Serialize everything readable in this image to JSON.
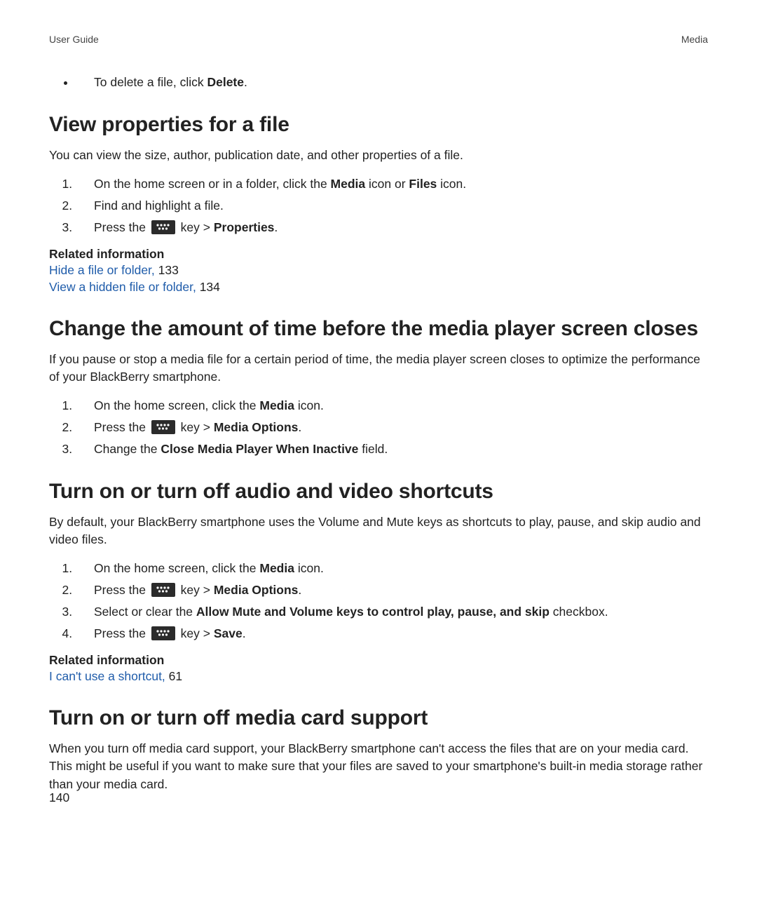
{
  "header": {
    "left": "User Guide",
    "right": "Media"
  },
  "bullet0": {
    "pre": "To delete a file, click ",
    "bold": "Delete",
    "post": "."
  },
  "sec1": {
    "title": "View properties for a file",
    "intro": "You can view the size, author, publication date, and other properties of a file.",
    "steps": {
      "s1_pre": "On the home screen or in a folder, click the ",
      "s1_b1": "Media",
      "s1_mid": " icon or ",
      "s1_b2": "Files",
      "s1_post": " icon.",
      "s2": "Find and highlight a file.",
      "s3_pre": "Press the ",
      "s3_mid": " key > ",
      "s3_bold": "Properties",
      "s3_post": "."
    },
    "rel_head": "Related information",
    "rel1_link": "Hide a file or folder, ",
    "rel1_pg": "133",
    "rel2_link": "View a hidden file or folder, ",
    "rel2_pg": "134"
  },
  "sec2": {
    "title": "Change the amount of time before the media player screen closes",
    "intro": "If you pause or stop a media file for a certain period of time, the media player screen closes to optimize the performance of your BlackBerry smartphone.",
    "steps": {
      "s1_pre": "On the home screen, click the ",
      "s1_bold": "Media",
      "s1_post": " icon.",
      "s2_pre": "Press the ",
      "s2_mid": " key > ",
      "s2_bold": "Media Options",
      "s2_post": ".",
      "s3_pre": "Change the ",
      "s3_bold": "Close Media Player When Inactive",
      "s3_post": " field."
    }
  },
  "sec3": {
    "title": "Turn on or turn off audio and video shortcuts",
    "intro": "By default, your BlackBerry smartphone uses the Volume and Mute keys as shortcuts to play, pause, and skip audio and video files.",
    "steps": {
      "s1_pre": "On the home screen, click the ",
      "s1_bold": "Media",
      "s1_post": " icon.",
      "s2_pre": "Press the ",
      "s2_mid": " key > ",
      "s2_bold": "Media Options",
      "s2_post": ".",
      "s3_pre": "Select or clear the ",
      "s3_bold": "Allow Mute and Volume keys to control play, pause, and skip",
      "s3_post": " checkbox.",
      "s4_pre": "Press the ",
      "s4_mid": " key > ",
      "s4_bold": "Save",
      "s4_post": "."
    },
    "rel_head": "Related information",
    "rel1_link": "I can't use a shortcut, ",
    "rel1_pg": "61"
  },
  "sec4": {
    "title": "Turn on or turn off media card support",
    "intro": "When you turn off media card support, your BlackBerry smartphone can't access the files that are on your media card. This might be useful if you want to make sure that your files are saved to your smartphone's built-in media storage rather than your media card."
  },
  "page_number": "140"
}
